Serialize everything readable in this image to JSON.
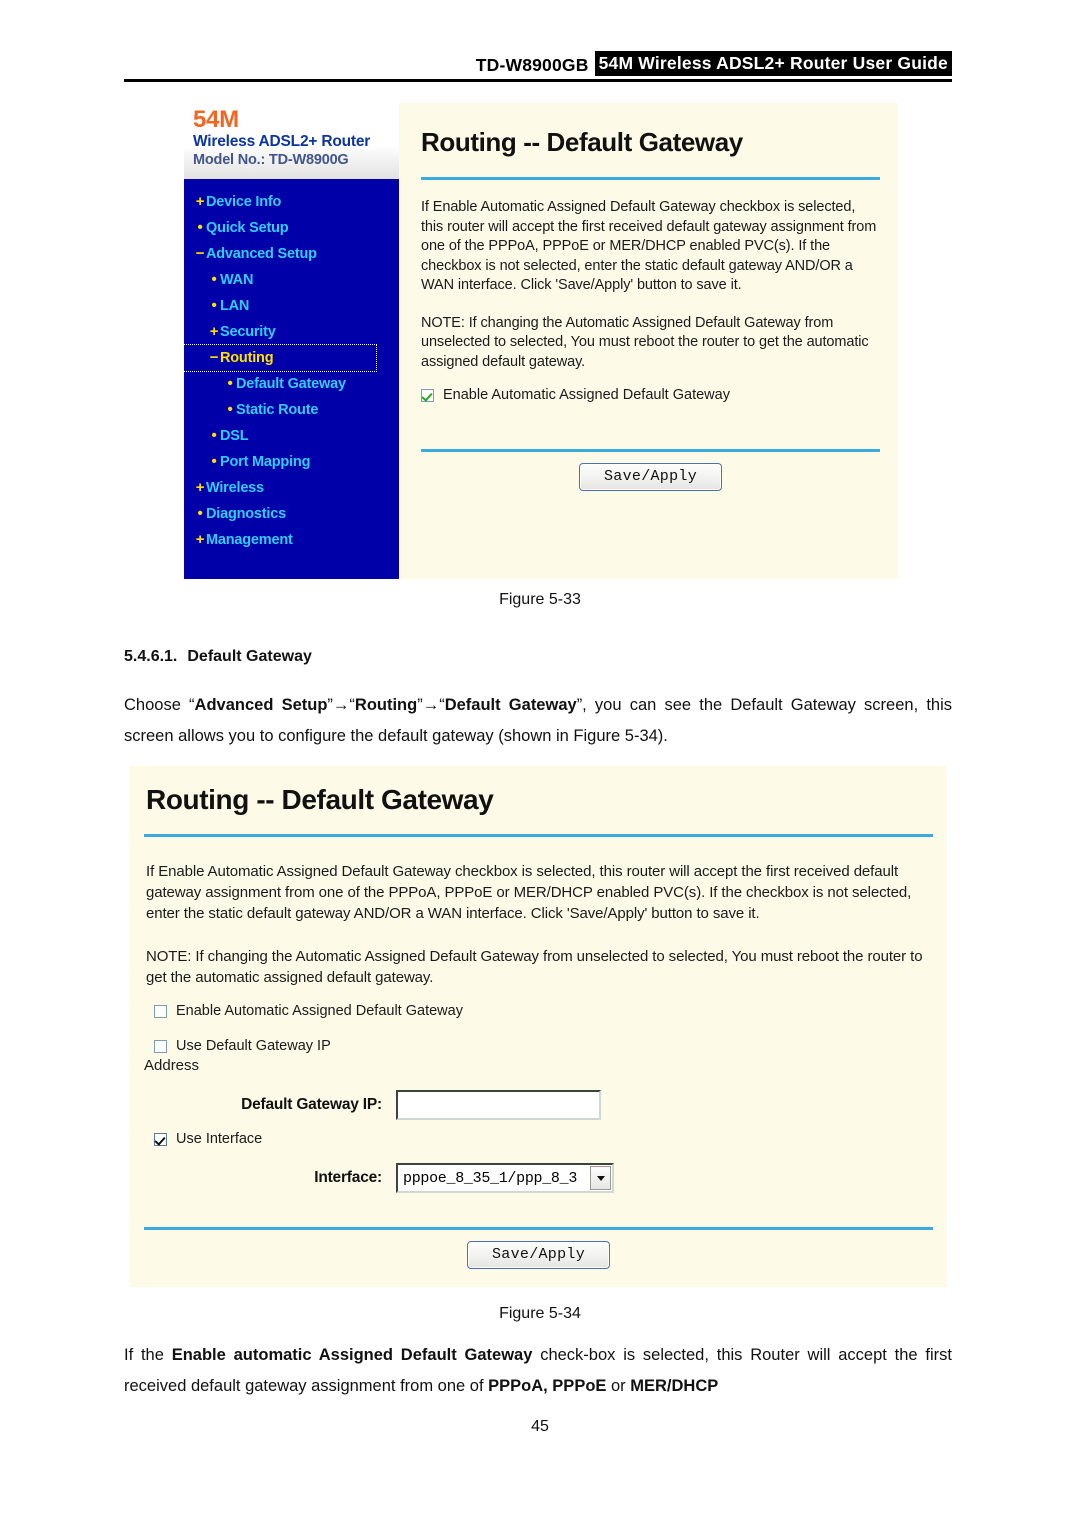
{
  "header": {
    "model": "TD-W8900GB",
    "title": "54M Wireless ADSL2+ Router User Guide"
  },
  "figure_5_33": {
    "caption": "Figure 5-33",
    "logo": {
      "speed": "54M",
      "product": "Wireless ADSL2+ Router",
      "model": "Model No.: TD-W8900G"
    },
    "nav": [
      {
        "mark": "+",
        "label": "Device Info",
        "level": 1,
        "selected": false
      },
      {
        "mark": "•",
        "label": "Quick Setup",
        "level": 1,
        "selected": false
      },
      {
        "mark": "−",
        "label": "Advanced Setup",
        "level": 1,
        "selected": false
      },
      {
        "mark": "•",
        "label": "WAN",
        "level": 2,
        "selected": false
      },
      {
        "mark": "•",
        "label": "LAN",
        "level": 2,
        "selected": false
      },
      {
        "mark": "+",
        "label": "Security",
        "level": 2,
        "selected": false
      },
      {
        "mark": "−",
        "label": "Routing",
        "level": 2,
        "selected": true
      },
      {
        "mark": "•",
        "label": "Default Gateway",
        "level": 3,
        "selected": false
      },
      {
        "mark": "•",
        "label": "Static Route",
        "level": 3,
        "selected": false
      },
      {
        "mark": "•",
        "label": "DSL",
        "level": 2,
        "selected": false
      },
      {
        "mark": "•",
        "label": "Port Mapping",
        "level": 2,
        "selected": false
      },
      {
        "mark": "+",
        "label": "Wireless",
        "level": 1,
        "selected": false
      },
      {
        "mark": "•",
        "label": "Diagnostics",
        "level": 1,
        "selected": false
      },
      {
        "mark": "+",
        "label": "Management",
        "level": 1,
        "selected": false
      }
    ],
    "panel_title": "Routing -- Default Gateway",
    "description": "If Enable Automatic Assigned Default Gateway checkbox is selected, this router will accept the first received default gateway assignment from one of the PPPoA, PPPoE or MER/DHCP enabled PVC(s). If the checkbox is not selected, enter the static default gateway AND/OR a WAN interface. Click 'Save/Apply' button to save it.",
    "note": "NOTE: If changing the Automatic Assigned Default Gateway from unselected to selected, You must reboot the router to get the automatic assigned default gateway.",
    "checkbox_label": "Enable Automatic Assigned Default Gateway",
    "checkbox_checked": true,
    "save_label": "Save/Apply"
  },
  "section": {
    "number": "5.4.6.1.",
    "title": "Default Gateway"
  },
  "intro_paragraph": {
    "p1": "Choose “",
    "b1": "Advanced Setup",
    "p2": "”→“",
    "b2": "Routing",
    "p3": "”→“",
    "b3": "Default Gateway",
    "p4": "”, you can see the Default Gateway screen, this screen allows you to configure the default gateway (shown in Figure 5-34)."
  },
  "figure_5_34": {
    "caption": "Figure 5-34",
    "panel_title": "Routing -- Default Gateway",
    "description": "If Enable Automatic Assigned Default Gateway checkbox is selected, this router will accept the first received default gateway assignment from one of the PPPoA, PPPoE or MER/DHCP enabled PVC(s). If the checkbox is not selected, enter the static default gateway AND/OR a WAN interface. Click 'Save/Apply' button to save it.",
    "note": "NOTE: If changing the Automatic Assigned Default Gateway from unselected to selected, You must reboot the router to get the automatic assigned default gateway.",
    "cb_enable_auto_label": "Enable Automatic Assigned Default Gateway",
    "cb_enable_auto_checked": false,
    "cb_use_gateway_ip_label": "Use Default Gateway IP",
    "cb_use_gateway_ip_checked": false,
    "address_word": "Address",
    "gateway_ip_label": "Default Gateway IP:",
    "gateway_ip_value": "",
    "cb_use_interface_label": "Use Interface",
    "cb_use_interface_checked": true,
    "interface_label": "Interface:",
    "interface_value": "pppoe_8_35_1/ppp_8_3",
    "save_label": "Save/Apply"
  },
  "closing_paragraph": {
    "p1": "If the ",
    "b1": "Enable automatic Assigned Default Gateway",
    "p2": " check-box is selected, this Router will accept the first received default gateway assignment from one of ",
    "b2": "PPPoA, PPPoE",
    "p3": " or ",
    "b3": "MER/DHCP"
  },
  "page_number": "45",
  "colors": {
    "sidebar_bg": "#0000a8",
    "nav_text": "#33ccff",
    "nav_mark": "#ffe000",
    "nav_selected": "#ffe000",
    "panel_bg": "#fdfbe8",
    "accent_rule": "#3aabe2",
    "logo_orange": "#f26522",
    "logo_blue": "#0b35a0"
  }
}
